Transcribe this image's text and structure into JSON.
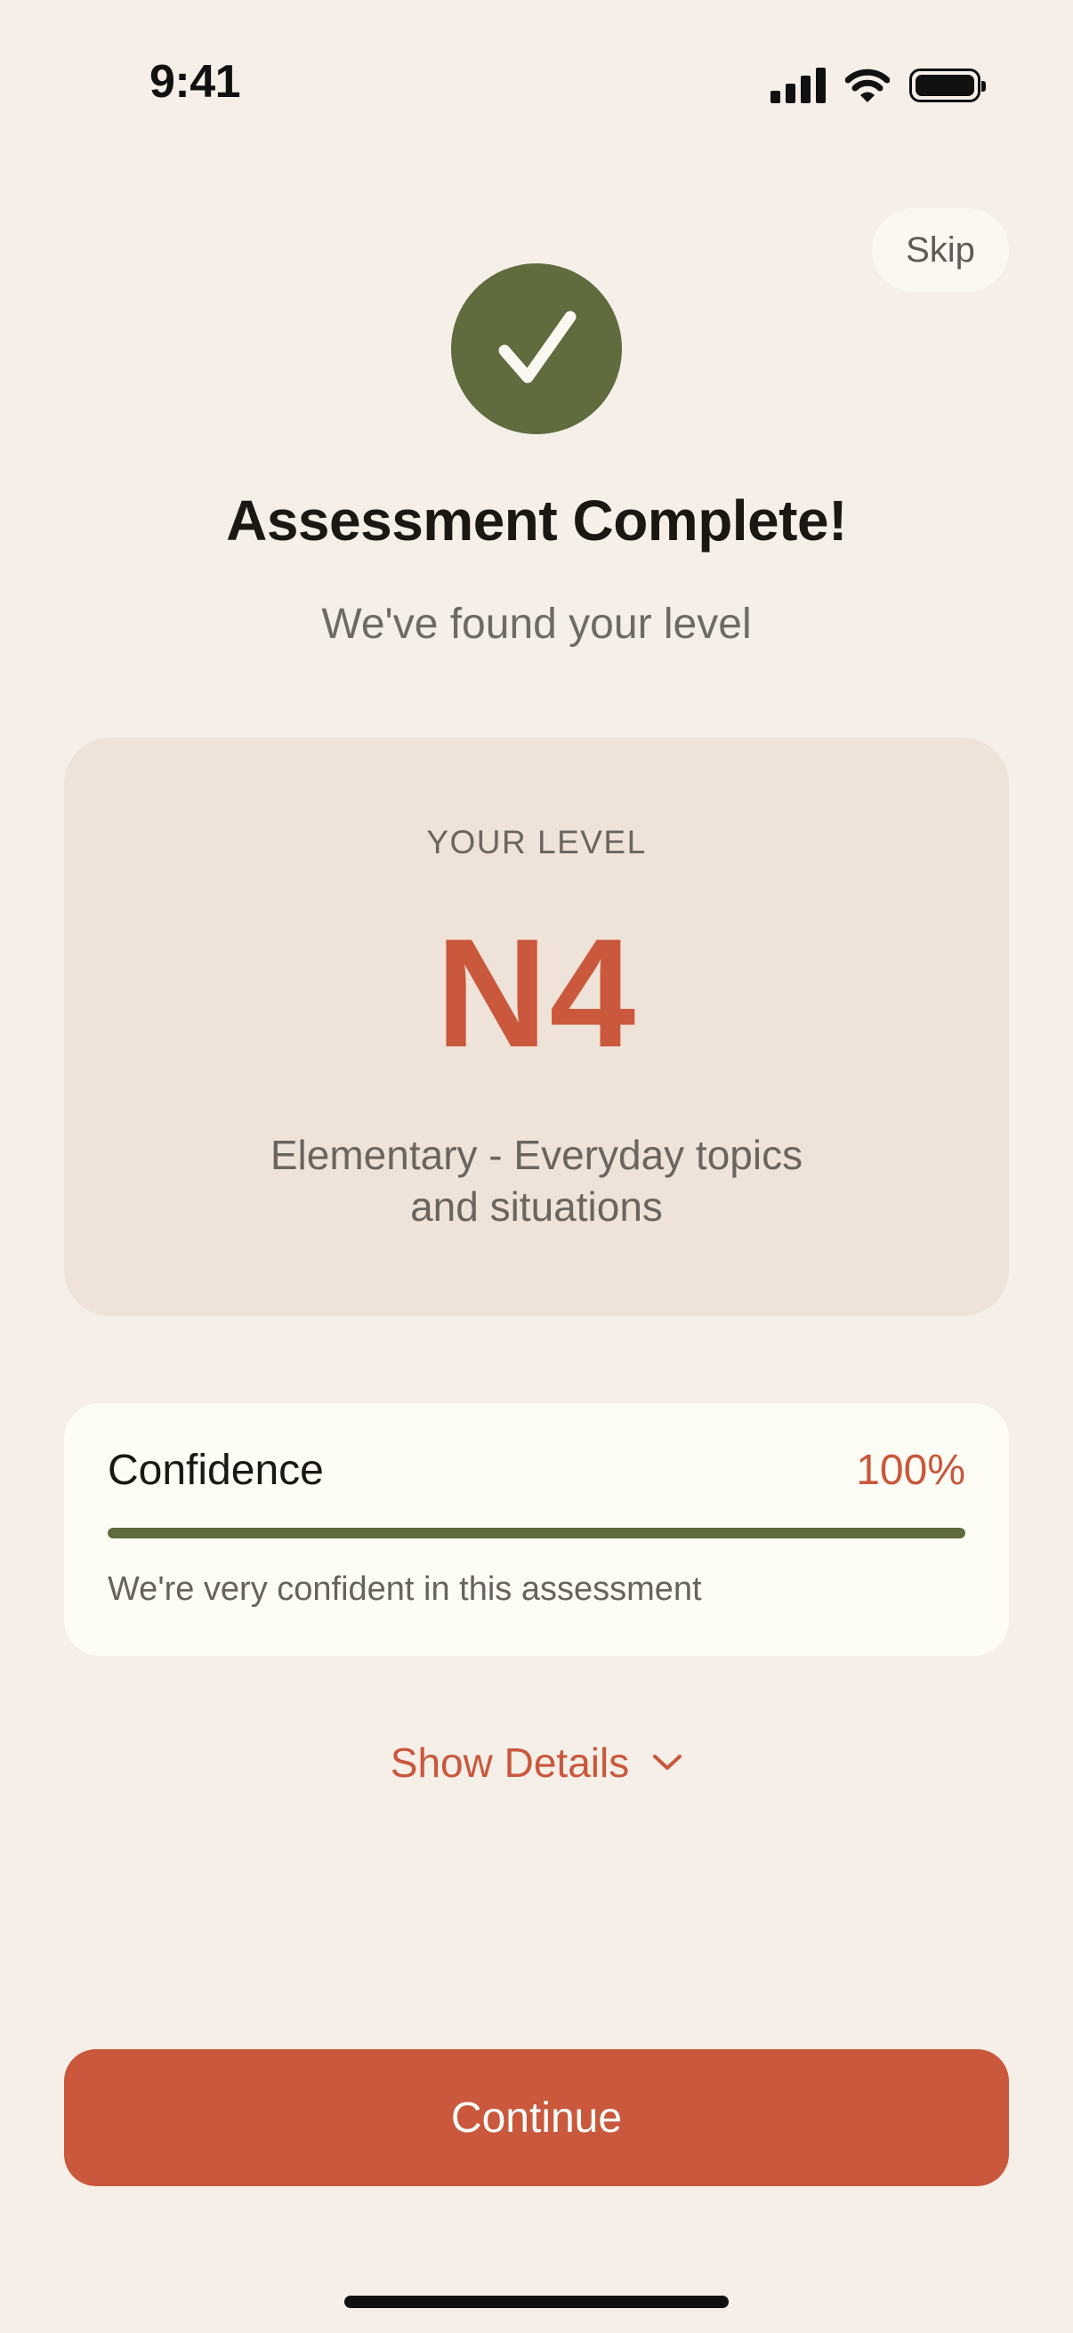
{
  "status_bar": {
    "time": "9:41",
    "icons": [
      "signal-icon",
      "wifi-icon",
      "battery-icon"
    ]
  },
  "header": {
    "skip_label": "Skip"
  },
  "result": {
    "icon": "checkmark-icon",
    "title": "Assessment Complete!",
    "subtitle": "We've found your level"
  },
  "level_card": {
    "caption": "YOUR LEVEL",
    "level": "N4",
    "description": "Elementary - Everyday topics and situations"
  },
  "confidence": {
    "label": "Confidence",
    "value_text": "100%",
    "value": 1.0,
    "note": "We're very confident in this assessment"
  },
  "details": {
    "label": "Show Details",
    "icon": "chevron-down-icon"
  },
  "actions": {
    "continue_label": "Continue"
  },
  "colors": {
    "background": "#F5EFE8",
    "accent": "#C9583C",
    "success": "#606B3E",
    "card": "#EFE2D8",
    "panel": "#FDFCF5"
  }
}
